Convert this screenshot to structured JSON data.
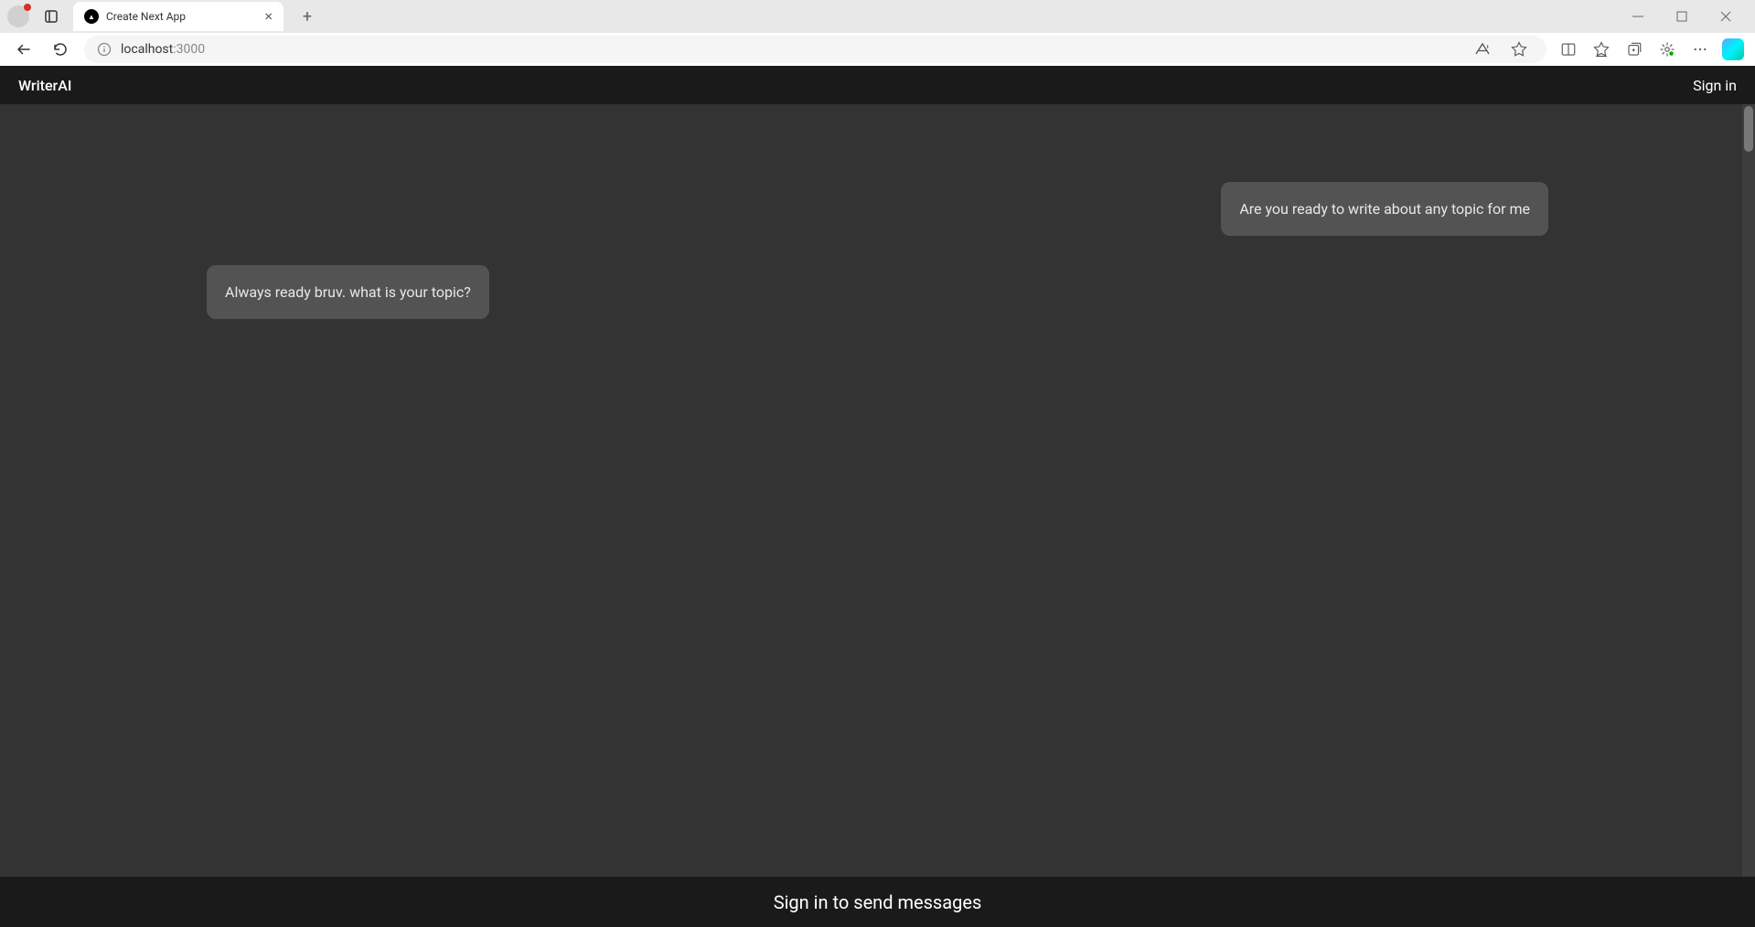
{
  "browser": {
    "tab": {
      "title": "Create Next App"
    },
    "url": {
      "host": "localhost",
      "port": ":3000"
    }
  },
  "app": {
    "header": {
      "logo": "WriterAI",
      "sign_in": "Sign in"
    },
    "messages": [
      {
        "side": "right",
        "text": "Are you ready to write about any topic for me"
      },
      {
        "side": "left",
        "text": "Always ready bruv. what is your topic?"
      }
    ],
    "footer": {
      "text": "Sign in to send messages"
    }
  }
}
